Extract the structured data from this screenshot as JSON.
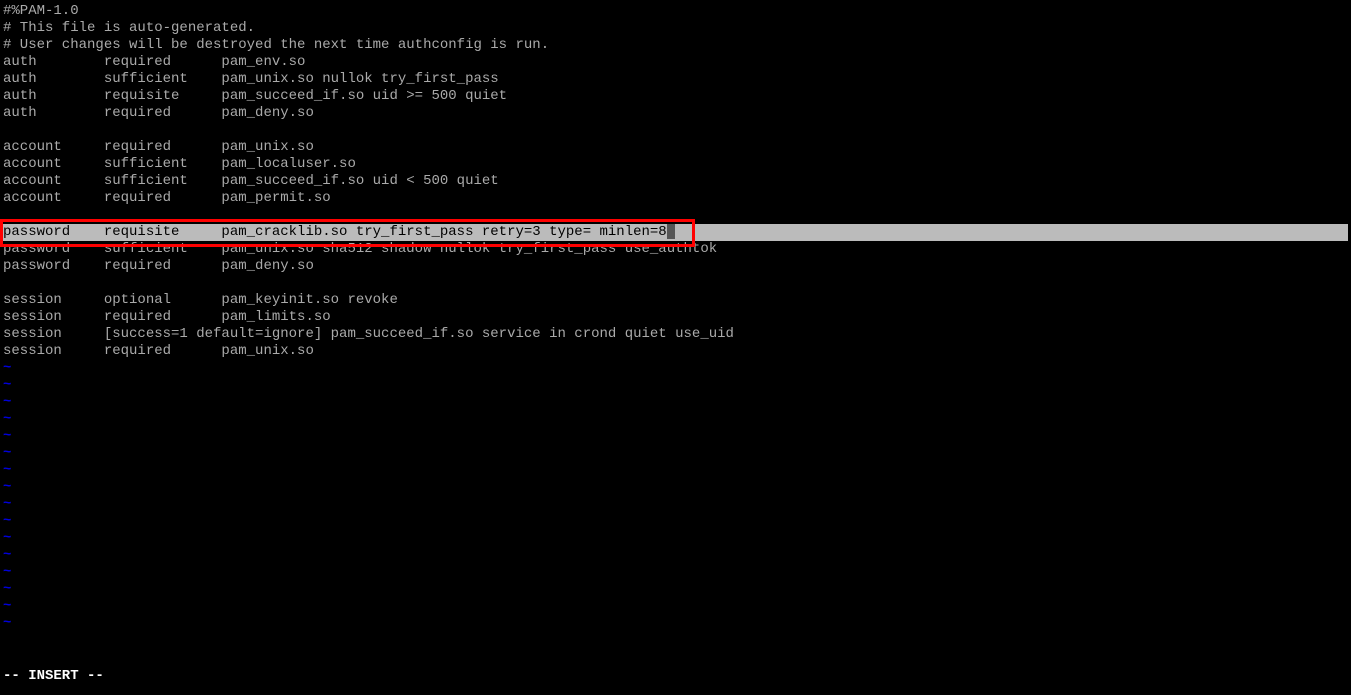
{
  "lines": [
    "#%PAM-1.0",
    "# This file is auto-generated.",
    "# User changes will be destroyed the next time authconfig is run.",
    "auth        required      pam_env.so",
    "auth        sufficient    pam_unix.so nullok try_first_pass",
    "auth        requisite     pam_succeed_if.so uid >= 500 quiet",
    "auth        required      pam_deny.so",
    "",
    "account     required      pam_unix.so",
    "account     sufficient    pam_localuser.so",
    "account     sufficient    pam_succeed_if.so uid < 500 quiet",
    "account     required      pam_permit.so",
    ""
  ],
  "highlighted": "password    requisite     pam_cracklib.so try_first_pass retry=3 type= minlen=8",
  "after_lines": [
    "password    sufficient    pam_unix.so sha512 shadow nullok try_first_pass use_authtok",
    "password    required      pam_deny.so",
    "",
    "session     optional      pam_keyinit.so revoke",
    "session     required      pam_limits.so",
    "session     [success=1 default=ignore] pam_succeed_if.so service in crond quiet use_uid",
    "session     required      pam_unix.so"
  ],
  "tilde": "~",
  "status": "-- INSERT --",
  "tilde_count": 16
}
